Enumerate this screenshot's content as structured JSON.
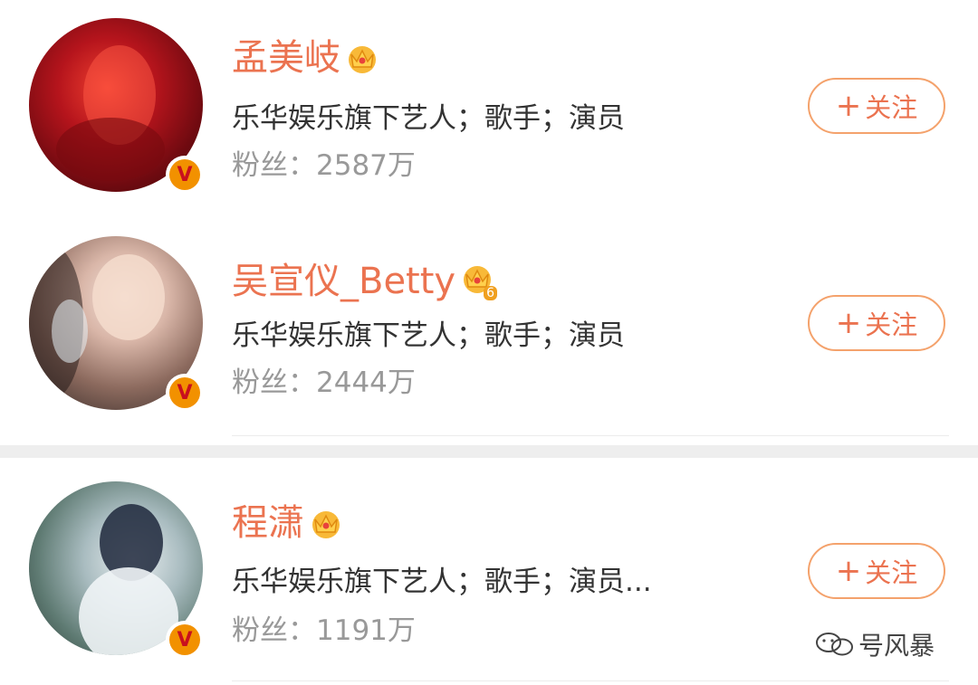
{
  "users": [
    {
      "name": "孟美岐",
      "description": "乐华娱乐旗下艺人；歌手；演员",
      "fans_label": "粉丝：",
      "fans_count": "2587万",
      "follow_label": "关注",
      "verified_badge": "V",
      "crown_icon": "crown-icon"
    },
    {
      "name": "吴宣仪_Betty",
      "description": "乐华娱乐旗下艺人；歌手；演员",
      "fans_label": "粉丝：",
      "fans_count": "2444万",
      "follow_label": "关注",
      "verified_badge": "V",
      "crown_icon": "crown-level-icon",
      "crown_level": "6"
    },
    {
      "name": "程潇",
      "description": "乐华娱乐旗下艺人；歌手；演员...",
      "fans_label": "粉丝：",
      "fans_count": "1191万",
      "follow_label": "关注",
      "verified_badge": "V",
      "crown_icon": "crown-icon"
    }
  ],
  "follow_plus": "+",
  "watermark": {
    "text": "号风暴"
  },
  "colors": {
    "name": "#eb7350",
    "follow_border": "#f4a26c",
    "badge": "#f29100",
    "description": "#333333",
    "fans": "#999999"
  }
}
